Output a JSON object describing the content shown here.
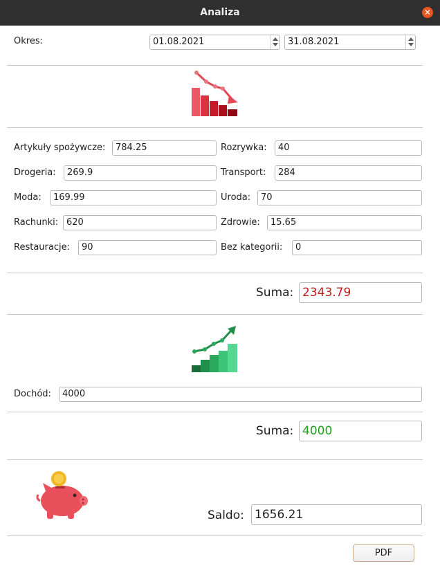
{
  "window": {
    "title": "Analiza"
  },
  "period": {
    "label": "Okres:",
    "from": "01.08.2021",
    "to": "31.08.2021"
  },
  "expenses": {
    "left": [
      {
        "label": "Artykuły spożywcze:",
        "value": "784.25"
      },
      {
        "label": "Drogeria:",
        "value": "269.9"
      },
      {
        "label": "Moda:",
        "value": "169.99"
      },
      {
        "label": "Rachunki:",
        "value": "620"
      },
      {
        "label": "Restauracje:",
        "value": "90"
      }
    ],
    "right": [
      {
        "label": "Rozrywka:",
        "value": "40"
      },
      {
        "label": "Transport:",
        "value": "284"
      },
      {
        "label": "Uroda:",
        "value": "70"
      },
      {
        "label": "Zdrowie:",
        "value": "15.65"
      },
      {
        "label": "Bez kategorii:",
        "value": "0"
      }
    ],
    "sum_label": "Suma:",
    "sum_value": "2343.79",
    "sum_color": "#c41a1a",
    "icon": "chart-decrease-icon"
  },
  "income": {
    "label": "Dochód:",
    "value": "4000",
    "sum_label": "Suma:",
    "sum_value": "4000",
    "sum_color": "#1fa21f",
    "icon": "chart-increase-icon"
  },
  "balance": {
    "label": "Saldo:",
    "value": "1656.21",
    "icon": "piggy-bank-icon"
  },
  "actions": {
    "pdf_label": "PDF"
  }
}
